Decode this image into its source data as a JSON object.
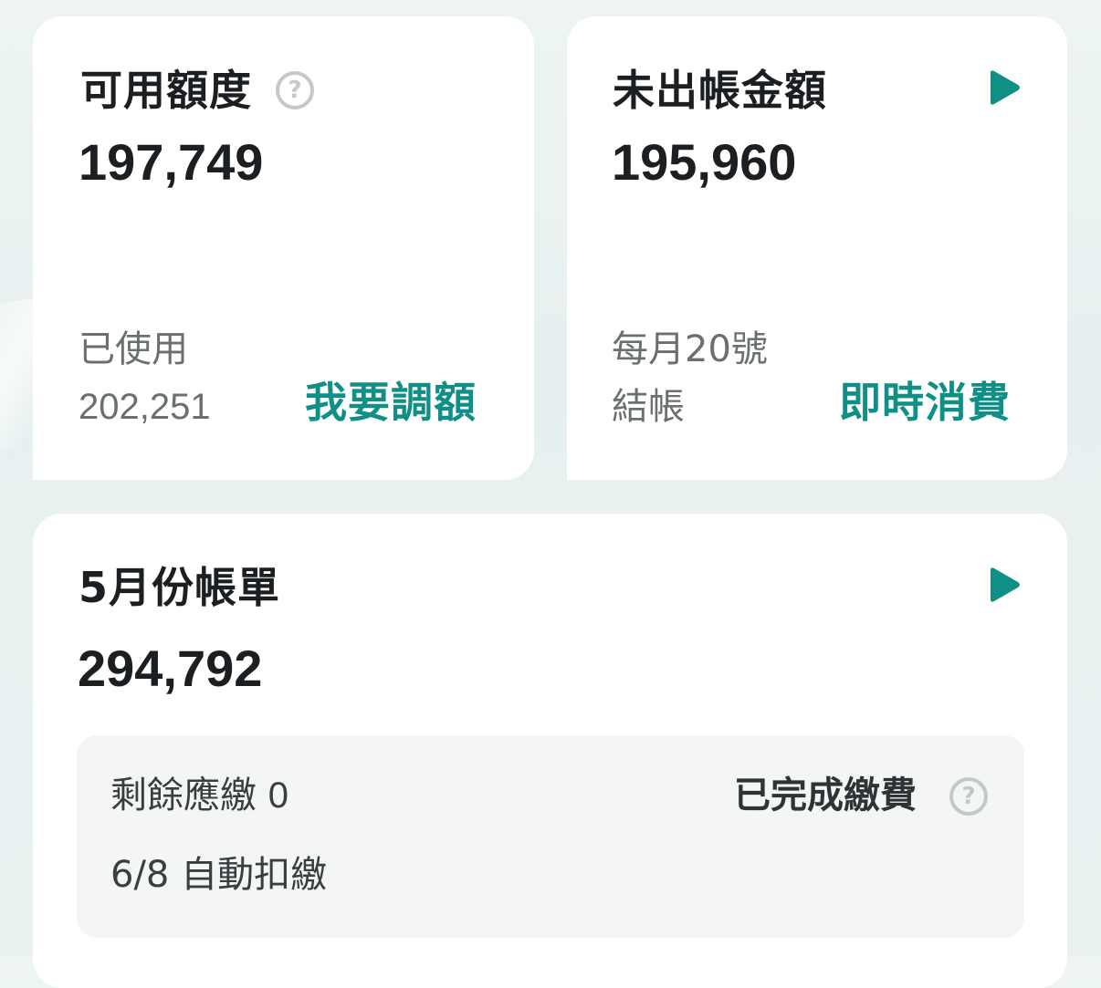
{
  "credit_card": {
    "title": "可用額度",
    "help_icon": "question-circle-icon",
    "amount": "197,749",
    "used_label": "已使用",
    "used_amount": "202,251",
    "action": "我要調額"
  },
  "unbilled_card": {
    "title": "未出帳金額",
    "arrow_icon": "play-arrow-icon",
    "amount": "195,960",
    "billing_day_line1": "每月20號",
    "billing_day_line2": "結帳",
    "action": "即時消費"
  },
  "bill_card": {
    "title": "5月份帳單",
    "arrow_icon": "play-arrow-icon",
    "amount": "294,792",
    "remaining_label": "剩餘應繳",
    "remaining_amount": "0",
    "status": "已完成繳費",
    "help_icon": "question-circle-icon",
    "autopay": "6/8 自動扣繳"
  },
  "colors": {
    "accent": "#0f8f86",
    "text_primary": "#1c1f21",
    "text_muted": "#6a6f72",
    "icon_gray": "#c5c8ca",
    "background": "#e9f1f1",
    "panel": "#f4f5f5"
  }
}
